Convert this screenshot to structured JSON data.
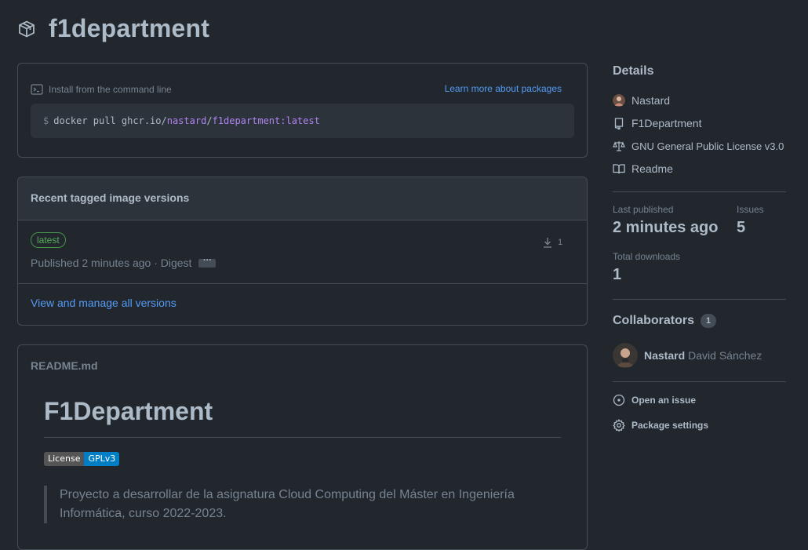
{
  "header": {
    "title": "f1department",
    "icon": "package-icon"
  },
  "install": {
    "label": "Install from the command line",
    "learn_more": "Learn more about packages",
    "cmd_prefix": "$",
    "cmd_base": "docker pull ghcr.io/",
    "cmd_owner": "nastard",
    "cmd_sep": "/",
    "cmd_image": "f1department:latest"
  },
  "versions": {
    "heading": "Recent tagged image versions",
    "items": [
      {
        "tag": "latest",
        "published": "Published 2 minutes ago · Digest",
        "downloads": "1"
      }
    ],
    "view_all": "View and manage all versions"
  },
  "readme": {
    "filename": "README.md",
    "heading": "F1Department",
    "badge_left": "License",
    "badge_right": "GPLv3",
    "quote": "Proyecto a desarrollar de la asignatura Cloud Computing del Máster en Ingeniería Informática, curso 2022-2023."
  },
  "sidebar": {
    "details_heading": "Details",
    "details": [
      {
        "icon": "user-avatar-icon",
        "label": "Nastard"
      },
      {
        "icon": "repo-icon",
        "label": "F1Department"
      },
      {
        "icon": "law-icon",
        "label": "GNU General Public License v3.0"
      },
      {
        "icon": "book-icon",
        "label": "Readme"
      }
    ],
    "last_published_label": "Last published",
    "last_published_value": "2 minutes ago",
    "issues_label": "Issues",
    "issues_value": "5",
    "downloads_label": "Total downloads",
    "downloads_value": "1",
    "collaborators_heading": "Collaborators",
    "collaborators_count": "1",
    "collaborator_login": "Nastard",
    "collaborator_name": "David Sánchez",
    "open_issue": "Open an issue",
    "package_settings": "Package settings"
  },
  "colors": {
    "background": "#22272e",
    "border": "#444c56",
    "link": "#539bf5",
    "tag_green": "#57ab5a",
    "accent_purple": "#b083f0"
  }
}
